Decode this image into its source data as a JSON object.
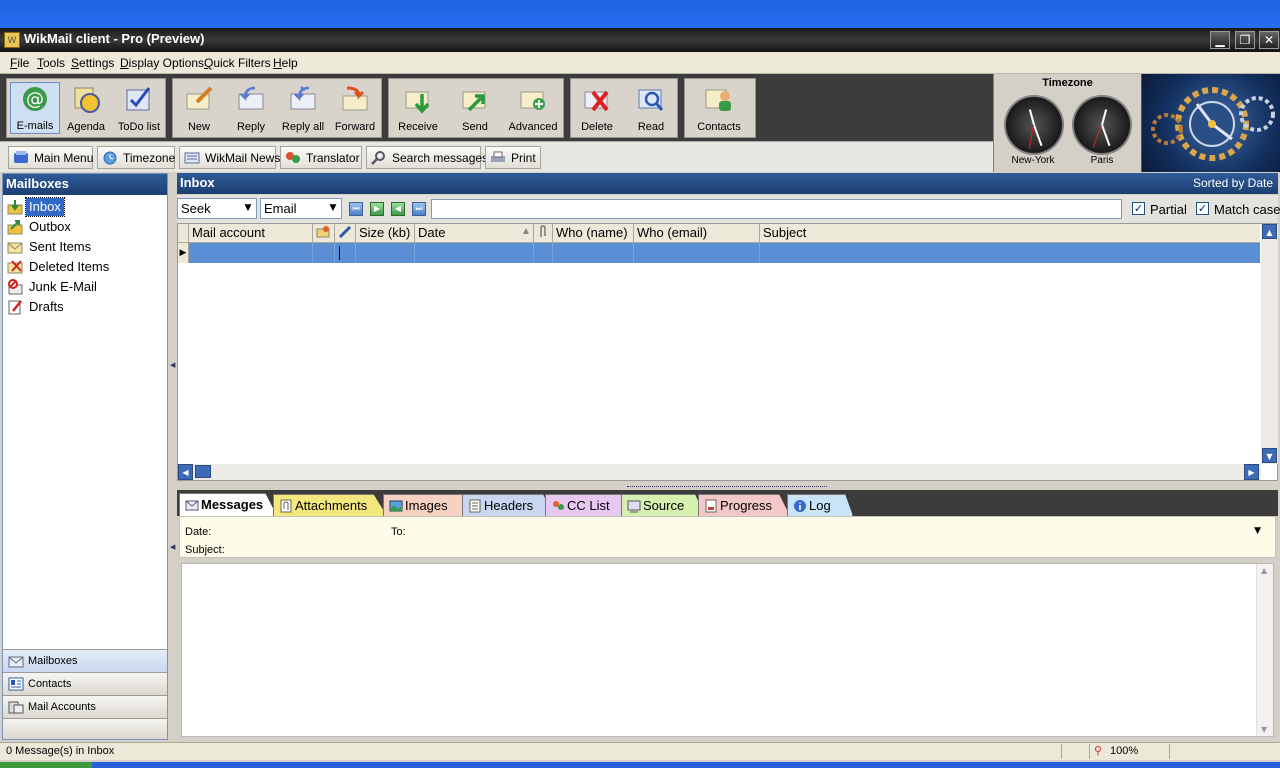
{
  "window": {
    "title": "WikMail client - Pro (Preview)"
  },
  "menu": [
    "File",
    "Tools",
    "Settings",
    "Display Options",
    "Quick Filters",
    "Help"
  ],
  "toolbar": {
    "buttons": [
      "E-mails",
      "Agenda",
      "ToDo list",
      "New",
      "Reply",
      "Reply all",
      "Forward",
      "Receive",
      "Send",
      "Advanced",
      "Delete",
      "Read",
      "Contacts"
    ],
    "active": "E-mails"
  },
  "subtoolbar": [
    "Main Menu",
    "Timezone",
    "WikMail News",
    "Translator",
    "Search messages",
    "Print"
  ],
  "timezone": {
    "title": "Timezone",
    "clocks": [
      "New-York",
      "Paris"
    ]
  },
  "mailboxes": {
    "header": "Mailboxes",
    "items": [
      "Inbox",
      "Outbox",
      "Sent Items",
      "Deleted Items",
      "Junk E-Mail",
      "Drafts"
    ],
    "selected": "Inbox"
  },
  "nav_buttons": [
    "Mailboxes",
    "Contacts",
    "Mail Accounts"
  ],
  "inbox": {
    "title": "Inbox",
    "sorted": "Sorted by Date"
  },
  "seek": {
    "mode": "Seek",
    "field": "Email",
    "search_value": "",
    "partial_label": "Partial",
    "match_case_label": "Match case",
    "partial_checked": true,
    "match_case_checked": true
  },
  "grid": {
    "columns": [
      "Mail account",
      "",
      "",
      "Size (kb)",
      "Date",
      "",
      "Who (name)",
      "Who (email)",
      "Subject"
    ],
    "rows": []
  },
  "tabs": [
    "Messages",
    "Attachments",
    "Images",
    "Headers",
    "CC List",
    "Source",
    "Progress",
    "Log"
  ],
  "active_tab": "Messages",
  "message": {
    "date_label": "Date:",
    "to_label": "To:",
    "subject_label": "Subject:"
  },
  "status": {
    "text": "0 Message(s) in Inbox",
    "zoom": "100%"
  },
  "colors": {
    "header_blue": "#1d3f71",
    "selection": "#5b8fd5",
    "toolbar_bg": "#3c3c3c"
  }
}
